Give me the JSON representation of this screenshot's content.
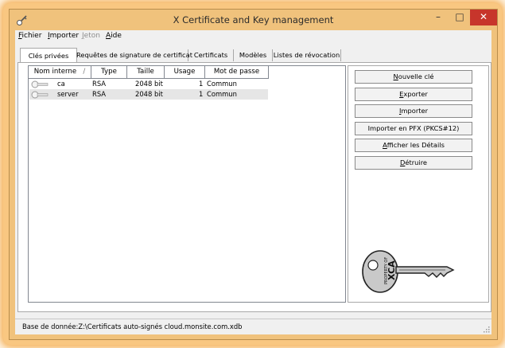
{
  "window": {
    "title": "X Certificate and Key management",
    "minimize": "–",
    "maximize": "□",
    "close": "✕"
  },
  "menu": {
    "items": [
      {
        "label": "Fichier",
        "hotkey": "F",
        "rest": "ichier",
        "enabled": true
      },
      {
        "label": "Importer",
        "hotkey": "I",
        "rest": "mporter",
        "enabled": true
      },
      {
        "label": "Jeton",
        "hotkey": "J",
        "rest": "eton",
        "enabled": false
      },
      {
        "label": "Aide",
        "hotkey": "A",
        "rest": "ide",
        "enabled": true
      }
    ]
  },
  "tabs": [
    {
      "label": "Clés privées",
      "active": true
    },
    {
      "label": "Requêtes de signature de certificat",
      "active": false
    },
    {
      "label": "Certificats",
      "active": false
    },
    {
      "label": "Modèles",
      "active": false
    },
    {
      "label": "Listes de révocation",
      "active": false
    }
  ],
  "keys_table": {
    "columns": [
      "Nom interne",
      "Type",
      "Taille",
      "Usage",
      "Mot de passe"
    ],
    "sort_indicator": "/",
    "rows": [
      {
        "name": "ca",
        "type": "RSA",
        "size": "2048 bit",
        "usage": "1",
        "password": "Commun"
      },
      {
        "name": "server",
        "type": "RSA",
        "size": "2048 bit",
        "usage": "1",
        "password": "Commun"
      }
    ]
  },
  "actions": [
    {
      "pre": "",
      "hot": "N",
      "post": "ouvelle clé"
    },
    {
      "pre": "",
      "hot": "E",
      "post": "xporter"
    },
    {
      "pre": "",
      "hot": "I",
      "post": "mporter"
    },
    {
      "pre": "Importer en PFX (PKCS#12)",
      "hot": "",
      "post": ""
    },
    {
      "pre": "",
      "hot": "A",
      "post": "fficher les Détails"
    },
    {
      "pre": "",
      "hot": "D",
      "post": "étruire"
    }
  ],
  "key_graphic": {
    "text": "XCA",
    "subtext": "PROPERTY OF"
  },
  "status": {
    "text": "Base de donnée:Z:\\Certificats auto-signés cloud.monsite.com.xdb"
  },
  "colors": {
    "frame": "#f0c27c",
    "close_button": "#c7352b",
    "row_alt": "#e6e6e6"
  }
}
